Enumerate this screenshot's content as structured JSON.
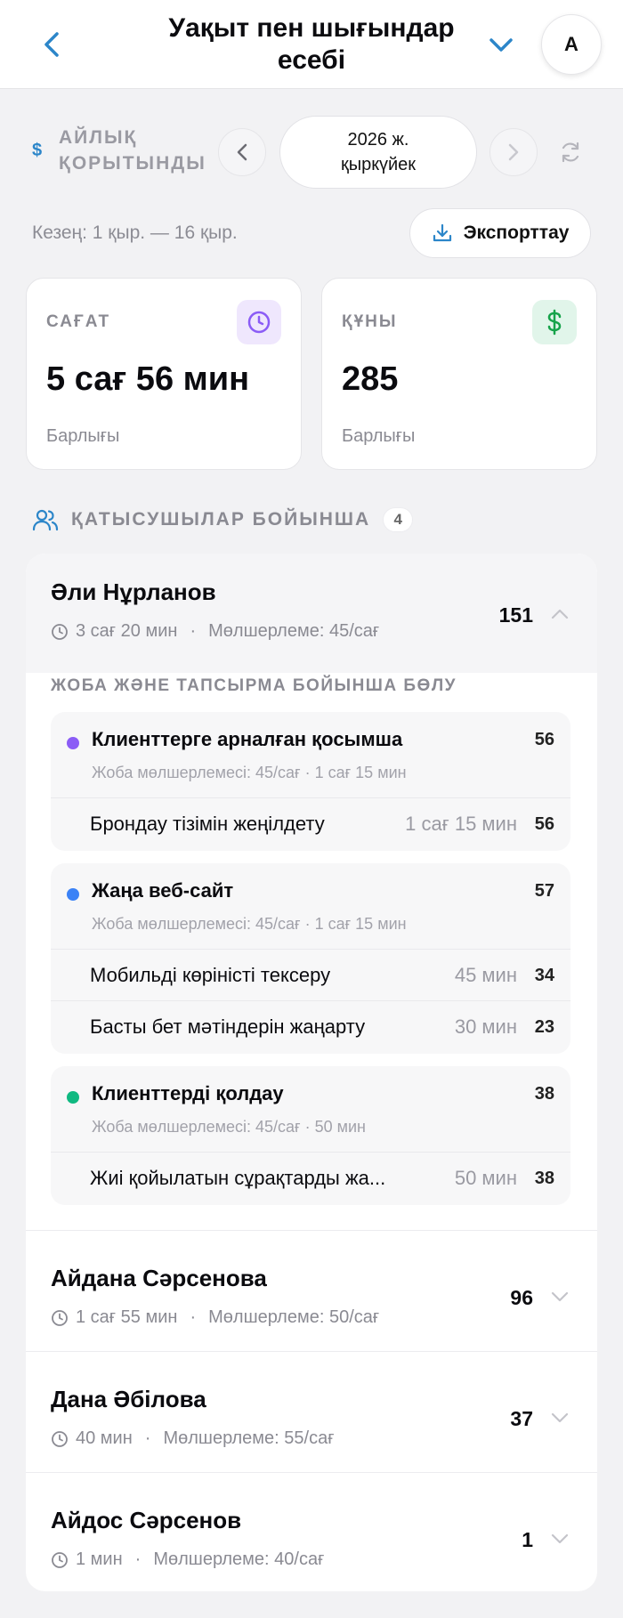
{
  "header": {
    "title_line1": "Уақыт пен шығындар",
    "title_line2": "есебі",
    "avatar_initial": "A"
  },
  "summary": {
    "icon": "dollar-icon",
    "label_line1": "АЙЛЫҚ",
    "label_line2": "ҚОРЫТЫНДЫ",
    "period_year": "2026 ж.",
    "period_month": "қыркүйек"
  },
  "range": {
    "text": "Кезең: 1 қыр. — 16 қыр.",
    "export_label": "Экспорттау"
  },
  "cards": {
    "hours": {
      "label": "САҒАТ",
      "value": "5 сағ 56 мин",
      "sub": "Барлығы",
      "icon": "clock-icon",
      "color": "#8b5cf6"
    },
    "cost": {
      "label": "ҚҰНЫ",
      "value": "285",
      "sub": "Барлығы",
      "icon": "dollar-icon",
      "color": "#16a34a"
    }
  },
  "participants": {
    "title": "ҚАТЫСУШЫЛАР БОЙЫНША",
    "count": "4",
    "breakdown_title": "ЖОБА ЖӘНЕ ТАПСЫРМА БОЙЫНША БӨЛУ",
    "items": [
      {
        "name": "Әли Нұрланов",
        "time": "3 сағ 20 мин",
        "rate": "Мөлшерлеме: 45/сағ",
        "amount": "151",
        "expanded": true,
        "projects": [
          {
            "name": "Клиенттерге арналған қосымша",
            "rate": "Жоба мөлшерлемесі: 45/сағ",
            "time": "1 сағ 15 мин",
            "amount": "56",
            "color": "#8b5cf6",
            "tasks": [
              {
                "name": "Брондау тізімін жеңілдету",
                "time": "1 сағ 15 мин",
                "amount": "56"
              }
            ]
          },
          {
            "name": "Жаңа веб-сайт",
            "rate": "Жоба мөлшерлемесі: 45/сағ",
            "time": "1 сағ 15 мин",
            "amount": "57",
            "color": "#3b82f6",
            "tasks": [
              {
                "name": "Мобильді көріністі тексеру",
                "time": "45 мин",
                "amount": "34"
              },
              {
                "name": "Басты бет мәтіндерін жаңарту",
                "time": "30 мин",
                "amount": "23"
              }
            ]
          },
          {
            "name": "Клиенттерді қолдау",
            "rate": "Жоба мөлшерлемесі: 45/сағ",
            "time": "50 мин",
            "amount": "38",
            "color": "#10b981",
            "tasks": [
              {
                "name": "Жиі қойылатын сұрақтарды жа...",
                "time": "50 мин",
                "amount": "38"
              }
            ]
          }
        ]
      },
      {
        "name": "Айдана Сәрсенова",
        "time": "1 сағ 55 мин",
        "rate": "Мөлшерлеме: 50/сағ",
        "amount": "96",
        "expanded": false
      },
      {
        "name": "Дана Әбілова",
        "time": "40 мин",
        "rate": "Мөлшерлеме: 55/сағ",
        "amount": "37",
        "expanded": false
      },
      {
        "name": "Айдос Сәрсенов",
        "time": "1 мин",
        "rate": "Мөлшерлеме: 40/сағ",
        "amount": "1",
        "expanded": false
      }
    ]
  },
  "colors": {
    "accent": "#2c86c9",
    "purple": "#8b5cf6",
    "green": "#16a34a"
  }
}
